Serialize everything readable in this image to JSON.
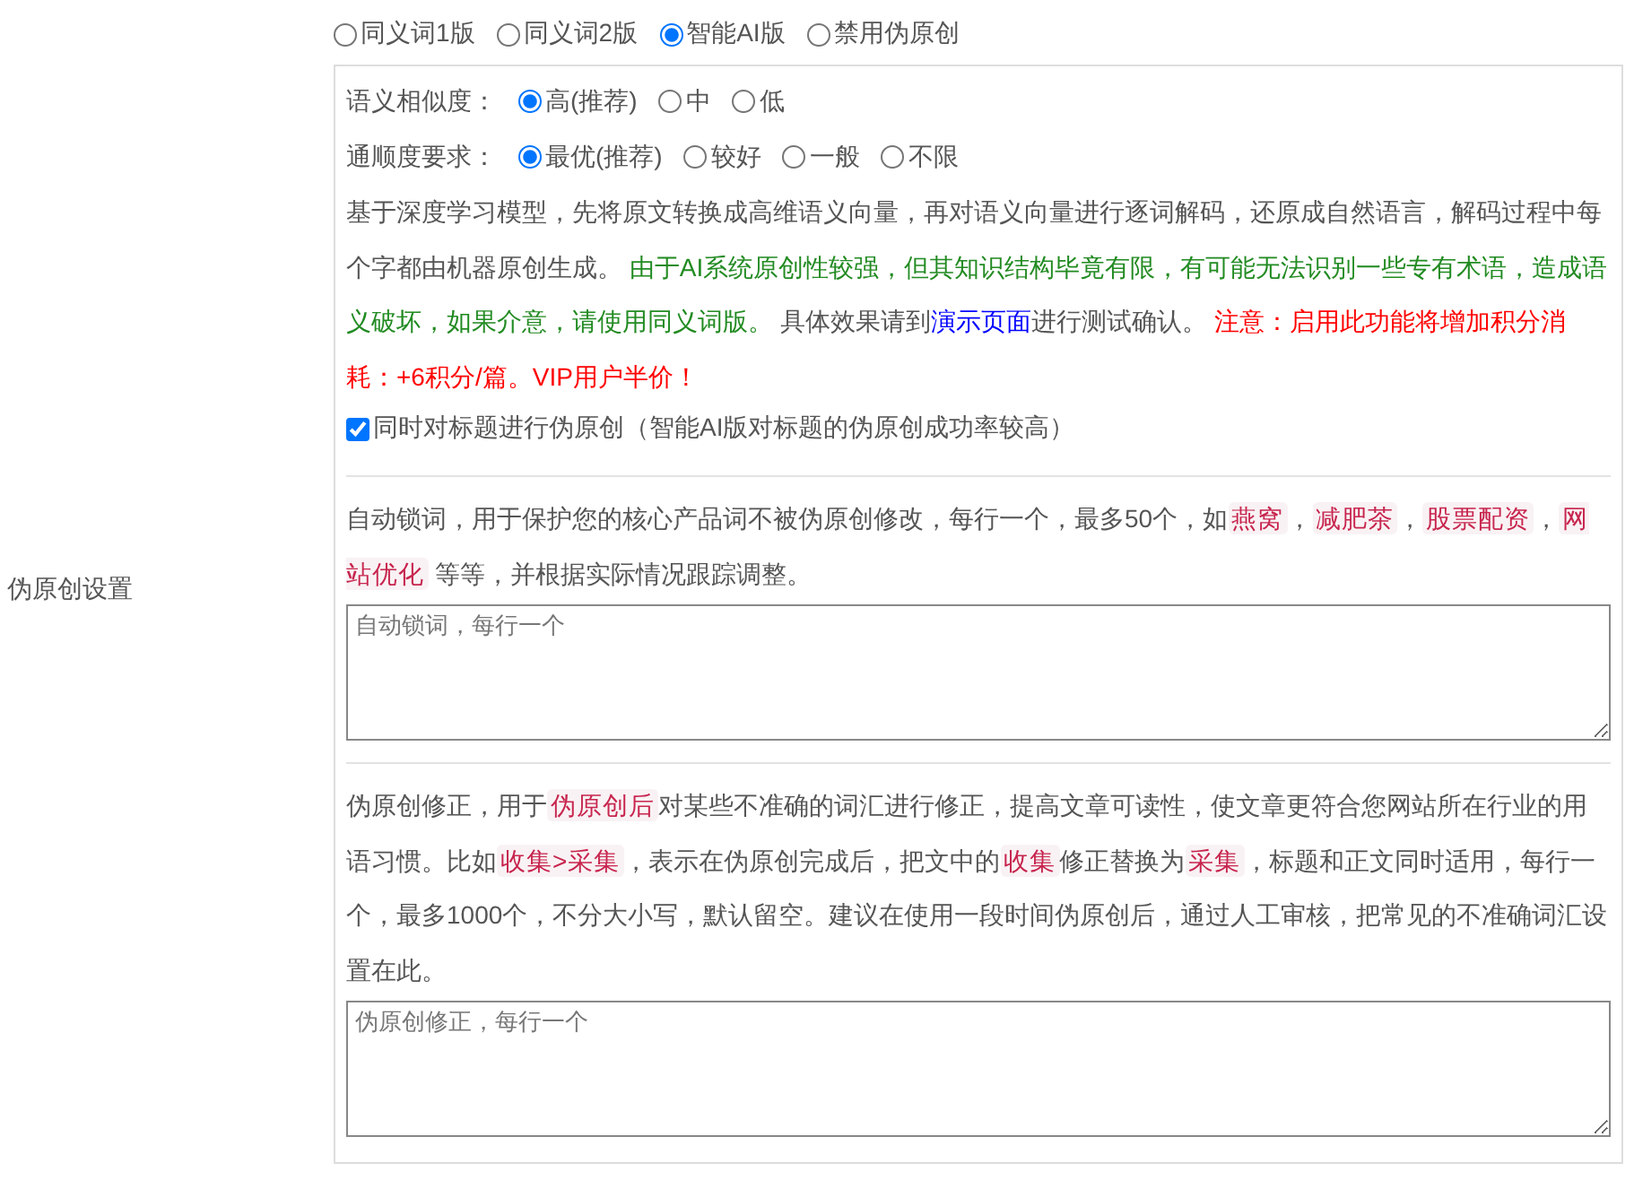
{
  "section_label": "伪原创设置",
  "modes": [
    {
      "label": "同义词1版",
      "selected": false
    },
    {
      "label": "同义词2版",
      "selected": false
    },
    {
      "label": "智能AI版",
      "selected": true
    },
    {
      "label": "禁用伪原创",
      "selected": false
    }
  ],
  "similarity": {
    "label": "语义相似度：",
    "options": [
      {
        "label": "高(推荐)",
        "selected": true
      },
      {
        "label": "中",
        "selected": false
      },
      {
        "label": "低",
        "selected": false
      }
    ]
  },
  "fluency": {
    "label": "通顺度要求：",
    "options": [
      {
        "label": "最优(推荐)",
        "selected": true
      },
      {
        "label": "较好",
        "selected": false
      },
      {
        "label": "一般",
        "selected": false
      },
      {
        "label": "不限",
        "selected": false
      }
    ]
  },
  "ai_description": [
    {
      "kind": "plain",
      "text": "基于深度学习模型，先将原文转换成高维语义向量，再对语义向量进行逐词解码，还原成自然语言，解码过程中每个字都由机器原创生成。 "
    },
    {
      "kind": "notice",
      "text": "由于AI系统原创性较强，但其知识结构毕竟有限，有可能无法识别一些专有术语，造成语义破坏，如果介意，请使用同义词版。"
    },
    {
      "kind": "plain",
      "text": " 具体效果请到"
    },
    {
      "kind": "link",
      "text": "演示页面"
    },
    {
      "kind": "plain",
      "text": "进行测试确认。 "
    },
    {
      "kind": "warning",
      "text": "注意：启用此功能将增加积分消耗：+6积分/篇。VIP用户半价！"
    }
  ],
  "title_option": {
    "label": "同时对标题进行伪原创（智能AI版对标题的伪原创成功率较高）",
    "checked": true
  },
  "lock_words": {
    "description": [
      {
        "kind": "plain",
        "text": "自动锁词，用于保护您的核心产品词不被伪原创修改，每行一个，最多50个，如"
      },
      {
        "kind": "tag",
        "text": "燕窝"
      },
      {
        "kind": "plain",
        "text": "，"
      },
      {
        "kind": "tag",
        "text": "减肥茶"
      },
      {
        "kind": "plain",
        "text": "，"
      },
      {
        "kind": "tag",
        "text": "股票配资"
      },
      {
        "kind": "plain",
        "text": "，"
      },
      {
        "kind": "tag",
        "text": "网站优化"
      },
      {
        "kind": "plain",
        "text": " 等等，并根据实际情况跟踪调整。"
      }
    ],
    "placeholder": "自动锁词，每行一个"
  },
  "corrections": {
    "description": [
      {
        "kind": "plain",
        "text": "伪原创修正，用于"
      },
      {
        "kind": "tag",
        "text": "伪原创后"
      },
      {
        "kind": "plain",
        "text": "对某些不准确的词汇进行修正，提高文章可读性，使文章更符合您网站所在行业的用语习惯。比如"
      },
      {
        "kind": "tag",
        "text": "收集>采集"
      },
      {
        "kind": "plain",
        "text": "，表示在伪原创完成后，把文中的"
      },
      {
        "kind": "tag",
        "text": "收集"
      },
      {
        "kind": "plain",
        "text": "修正替换为"
      },
      {
        "kind": "tag",
        "text": "采集"
      },
      {
        "kind": "plain",
        "text": "，标题和正文同时适用，每行一个，最多1000个，不分大小写，默认留空。建议在使用一段时间伪原创后，通过人工审核，把常见的不准确词汇设置在此。"
      }
    ],
    "placeholder": "伪原创修正，每行一个"
  }
}
